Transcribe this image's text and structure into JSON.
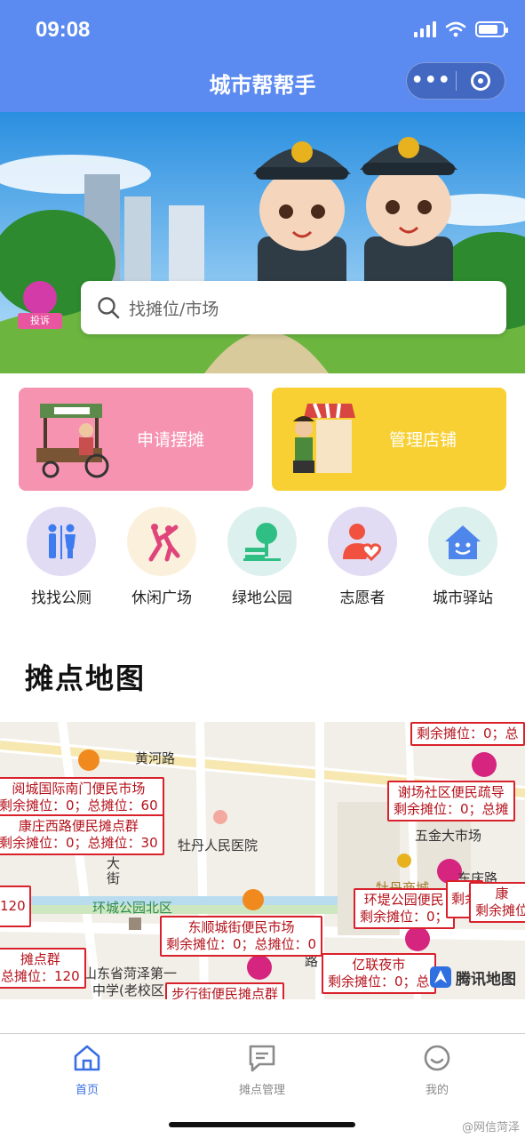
{
  "status_bar": {
    "time": "09:08"
  },
  "header": {
    "title": "城市帮帮手",
    "more_icon": "more-dots-icon",
    "close_icon": "target-circle-icon"
  },
  "banner": {
    "complaint_label": "投诉",
    "search": {
      "placeholder": "找摊位/市场",
      "icon": "search-icon"
    }
  },
  "action_cards": [
    {
      "label": "申请摆摊",
      "color": "#f693b0"
    },
    {
      "label": "管理店铺",
      "color": "#f8d033"
    }
  ],
  "shortcuts": [
    {
      "label": "找找公厕",
      "icon": "restroom-icon"
    },
    {
      "label": "休闲广场",
      "icon": "dance-icon"
    },
    {
      "label": "绿地公园",
      "icon": "park-icon"
    },
    {
      "label": "志愿者",
      "icon": "volunteer-icon"
    },
    {
      "label": "城市驿站",
      "icon": "house-icon"
    }
  ],
  "section": {
    "title": "摊点地图"
  },
  "map": {
    "places": [
      "黄河路",
      "牡丹人民医院",
      "五金大市场",
      "环城公园北区",
      "山东省菏泽第一",
      "中学(老校区)",
      "牡丹商城",
      "东庆路",
      "大",
      "街",
      "路"
    ],
    "markers": [
      {
        "name": "",
        "info": "剩余摊位：0；总"
      },
      {
        "name": "阅城国际南门便民市场",
        "info": "剩余摊位：0；总摊位：60"
      },
      {
        "name": "谢场社区便民疏导",
        "info": "剩余摊位：0；总摊"
      },
      {
        "name": "康庄西路便民摊点群",
        "info": "剩余摊位：0；总摊位：30"
      },
      {
        "name": "",
        "info": "120"
      },
      {
        "name": "环堤公园便民",
        "info": "剩余摊位：0；"
      },
      {
        "name": "剩余",
        "info": ""
      },
      {
        "name": "康",
        "info": "剩余摊位"
      },
      {
        "name": "东顺城街便民市场",
        "info": "剩余摊位：0；总摊位：0"
      },
      {
        "name": "摊点群",
        "info": "总摊位：120"
      },
      {
        "name": "亿联夜市",
        "info": "剩余摊位：0；总"
      },
      {
        "name": "步行街便民摊点群",
        "info": ""
      }
    ],
    "provider": "腾讯地图"
  },
  "tabbar": [
    {
      "label": "首页",
      "icon": "home-icon",
      "active": true
    },
    {
      "label": "摊点管理",
      "icon": "message-icon",
      "active": false
    },
    {
      "label": "我的",
      "icon": "smile-icon",
      "active": false
    }
  ],
  "watermark": "@网信菏泽"
}
